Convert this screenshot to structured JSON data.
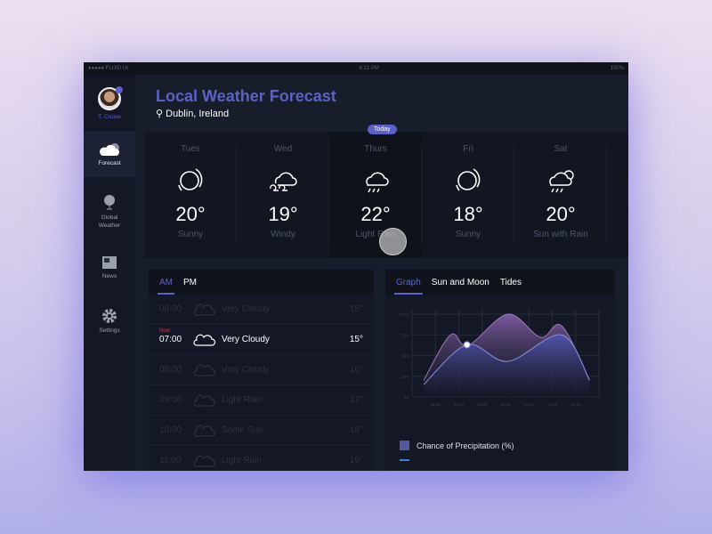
{
  "status": {
    "carrier": "●●●●● FLUID UI",
    "time": "4:21 PM",
    "battery": "100%"
  },
  "user": {
    "name": "T. Cruise"
  },
  "sidebar": {
    "items": [
      {
        "label": "Forecast",
        "icon": "cloud-icon",
        "active": true
      },
      {
        "label": "Global Weather",
        "icon": "globe-icon"
      },
      {
        "label": "News",
        "icon": "newspaper-icon"
      },
      {
        "label": "Settings",
        "icon": "gear-icon"
      }
    ]
  },
  "header": {
    "title": "Local Weather Forecast",
    "location": "Dublin, Ireland"
  },
  "today_badge": "Today",
  "days": [
    {
      "day": "Tues",
      "temp": "20°",
      "cond": "Sunny",
      "icon": "sun"
    },
    {
      "day": "Wed",
      "temp": "19°",
      "cond": "Windy",
      "icon": "wind"
    },
    {
      "day": "Thurs",
      "temp": "22°",
      "cond": "Light Rain",
      "icon": "rain",
      "today": true
    },
    {
      "day": "Fri",
      "temp": "18°",
      "cond": "Sunny",
      "icon": "sun"
    },
    {
      "day": "Sat",
      "temp": "20°",
      "cond": "Sun with Rain",
      "icon": "sunrain"
    }
  ],
  "hourly": {
    "tabs": [
      "AM",
      "PM"
    ],
    "now_label": "Now",
    "rows": [
      {
        "time": "06:00",
        "cond": "Very Cloudy",
        "temp": "15°"
      },
      {
        "time": "07:00",
        "cond": "Very Cloudy",
        "temp": "15°",
        "now": true
      },
      {
        "time": "08:00",
        "cond": "Very Cloudy",
        "temp": "16°"
      },
      {
        "time": "09:00",
        "cond": "Light Rain",
        "temp": "17°"
      },
      {
        "time": "10:00",
        "cond": "Some Sun",
        "temp": "18°"
      },
      {
        "time": "11:00",
        "cond": "Light Rain",
        "temp": "19°"
      }
    ]
  },
  "graph": {
    "tabs": [
      "Graph",
      "Sun and Moon",
      "Tides"
    ],
    "legend": "Chance of Precipitation (%)"
  },
  "chart_data": {
    "type": "area",
    "x_ticks": [
      "02:00",
      "04:00",
      "06:00",
      "08:00",
      "10:00",
      "12:00",
      "14:00"
    ],
    "y_ticks": [
      "0%",
      "25%",
      "50%",
      "75%",
      "100%"
    ],
    "xlim": [
      0,
      16
    ],
    "ylim": [
      0,
      100
    ],
    "grid": true,
    "series": [
      {
        "color": "#7a5a9e",
        "points": [
          [
            1,
            20
          ],
          [
            3.3,
            75
          ],
          [
            4.8,
            62
          ],
          [
            8.2,
            100
          ],
          [
            11,
            72
          ],
          [
            12.8,
            86
          ],
          [
            15.2,
            20
          ]
        ]
      },
      {
        "color": "#4f50a0",
        "points": [
          [
            1,
            15
          ],
          [
            4.7,
            63
          ],
          [
            8.2,
            43
          ],
          [
            12.8,
            75
          ],
          [
            15.2,
            20
          ]
        ]
      }
    ],
    "highlight": [
      4.7,
      63
    ]
  },
  "colors": {
    "accent": "#5b62c4",
    "now": "#d2364a"
  }
}
